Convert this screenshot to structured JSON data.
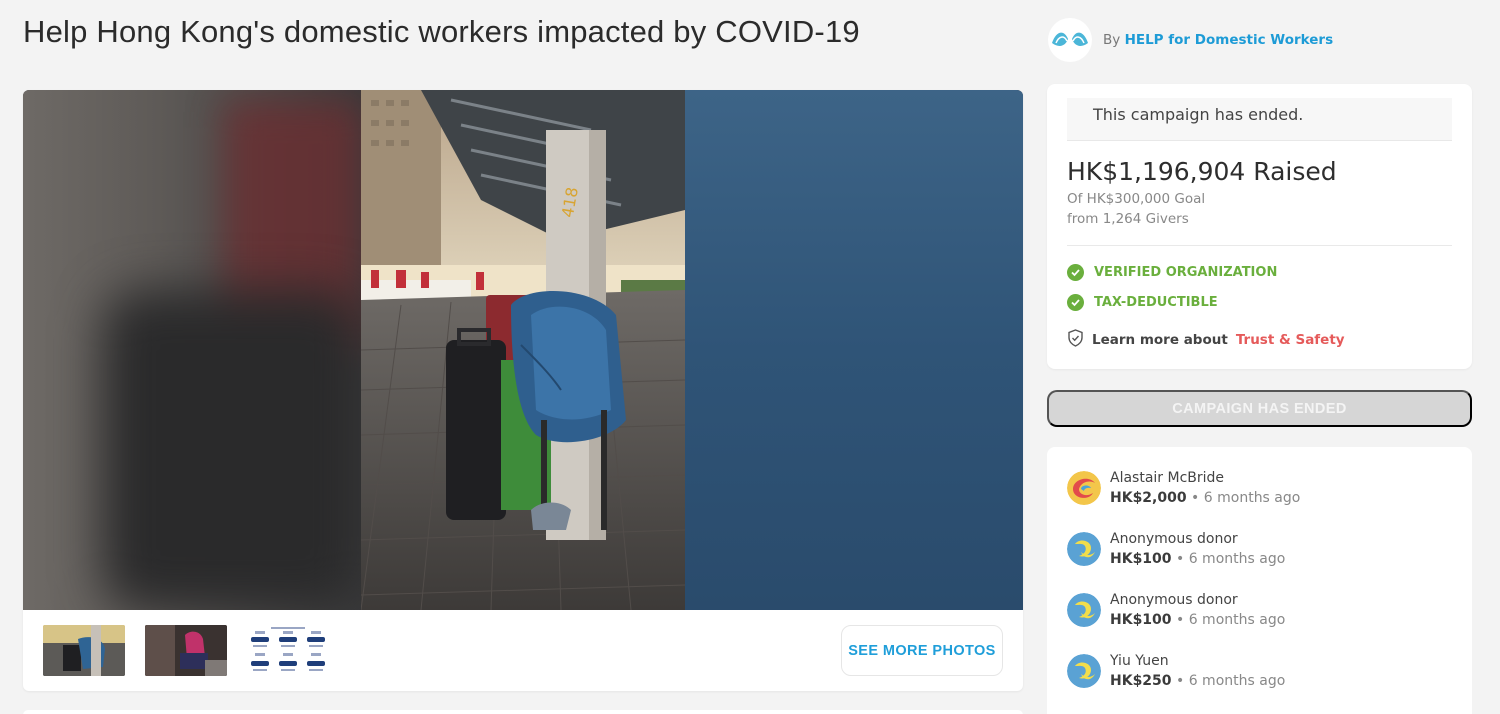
{
  "campaign": {
    "title": "Help Hong Kong's domestic workers impacted by COVID-19"
  },
  "organizer": {
    "by_label": "By",
    "name": "HELP for Domestic Workers"
  },
  "gallery": {
    "see_more_label": "SEE MORE PHOTOS",
    "thumbnail_icons": [
      "photo-thumbnail",
      "photo-thumbnail",
      "infographic-thumbnail"
    ]
  },
  "status": {
    "ended_message": "This campaign has ended.",
    "raised": "HK$1,196,904 Raised",
    "goal": "Of HK$300,000 Goal",
    "givers": "from 1,264 Givers",
    "badges": [
      "VERIFIED ORGANIZATION",
      "TAX-DEDUCTIBLE"
    ],
    "trust_prefix": "Learn more about",
    "trust_link": "Trust & Safety",
    "accent_green": "#6aaf3d",
    "accent_red": "#e55a5a"
  },
  "cta": {
    "ended_button_label": "CAMPAIGN HAS ENDED"
  },
  "donors": [
    {
      "name": "Alastair McBride",
      "amount": "HK$2,000",
      "time": "6 months ago",
      "avatar": "colorful-avatar"
    },
    {
      "name": "Anonymous donor",
      "amount": "HK$100",
      "time": "6 months ago",
      "avatar": "default-avatar"
    },
    {
      "name": "Anonymous donor",
      "amount": "HK$100",
      "time": "6 months ago",
      "avatar": "default-avatar"
    },
    {
      "name": "Yiu Yuen",
      "amount": "HK$250",
      "time": "6 months ago",
      "avatar": "default-avatar"
    }
  ],
  "brand_color": "#1d9bd6"
}
